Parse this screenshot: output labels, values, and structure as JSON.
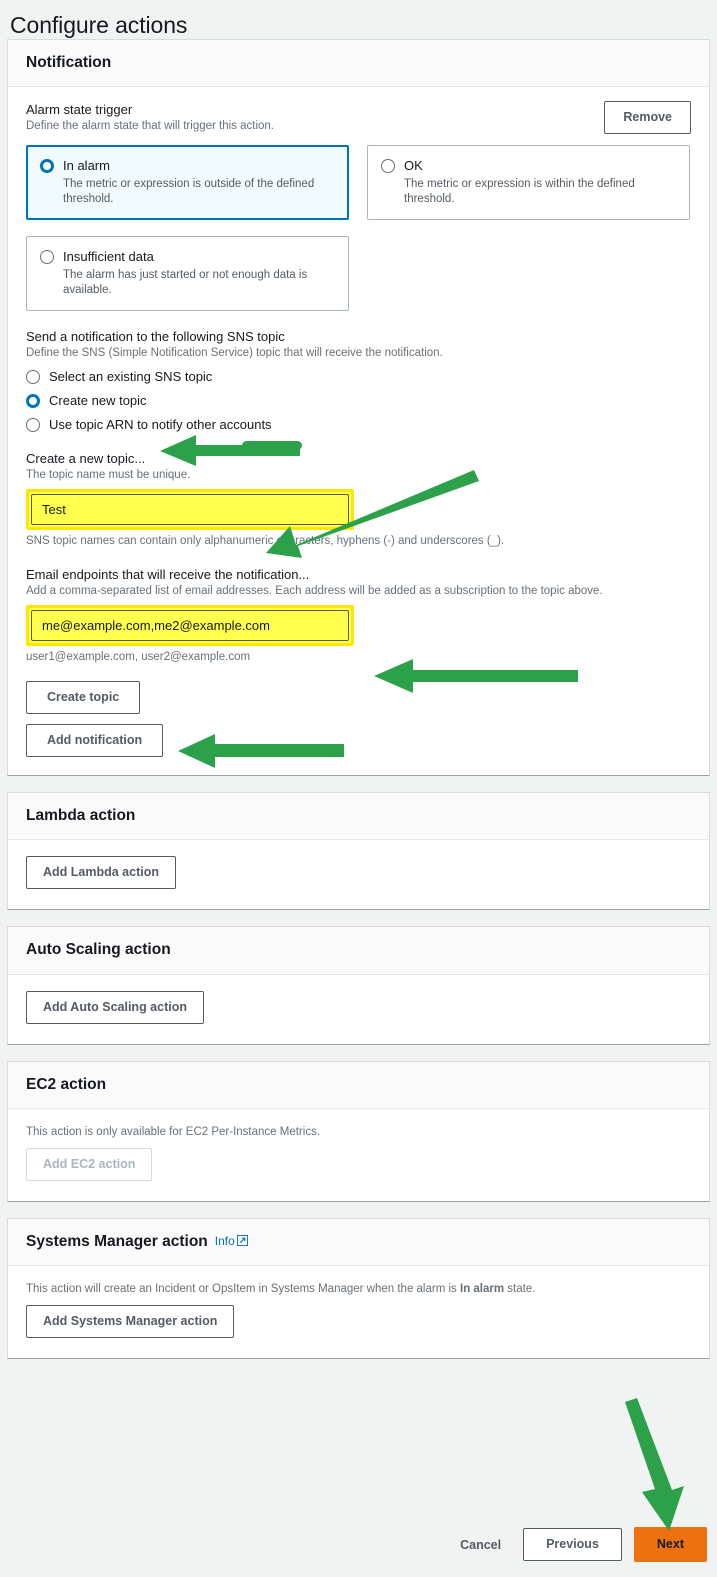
{
  "page": {
    "title": "Configure actions",
    "accent_green": "#2CA14A",
    "accent_orange": "#ec7211",
    "highlight_yellow": "#ffff4d",
    "link_blue": "#0073bb"
  },
  "notification": {
    "heading": "Notification",
    "remove_label": "Remove",
    "alarm_state_trigger": {
      "label": "Alarm state trigger",
      "description": "Define the alarm state that will trigger this action.",
      "options": [
        {
          "title": "In alarm",
          "description": "The metric or expression is outside of the defined threshold.",
          "selected": true
        },
        {
          "title": "OK",
          "description": "The metric or expression is within the defined threshold.",
          "selected": false
        },
        {
          "title": "Insufficient data",
          "description": "The alarm has just started or not enough data is available.",
          "selected": false
        }
      ]
    },
    "sns": {
      "label": "Send a notification to the following SNS topic",
      "description": "Define the SNS (Simple Notification Service) topic that will receive the notification.",
      "options": [
        {
          "label": "Select an existing SNS topic",
          "selected": false
        },
        {
          "label": "Create new topic",
          "selected": true
        },
        {
          "label": "Use topic ARN to notify other accounts",
          "selected": false
        }
      ]
    },
    "topic_name": {
      "label": "Create a new topic...",
      "description": "The topic name must be unique.",
      "value": "Test",
      "placeholder": "",
      "hint": "SNS topic names can contain only alphanumeric characters, hyphens (-) and underscores (_)."
    },
    "email_endpoints": {
      "label": "Email endpoints that will receive the notification...",
      "description": "Add a comma-separated list of email addresses. Each address will be added as a subscription to the topic above.",
      "value": "me@example.com,me2@example.com",
      "placeholder": "",
      "hint": "user1@example.com, user2@example.com"
    },
    "create_topic_label": "Create topic",
    "add_notification_label": "Add notification"
  },
  "lambda": {
    "heading": "Lambda action",
    "add_label": "Add Lambda action"
  },
  "autoscaling": {
    "heading": "Auto Scaling action",
    "add_label": "Add Auto Scaling action"
  },
  "ec2": {
    "heading": "EC2 action",
    "note": "This action is only available for EC2 Per-Instance Metrics.",
    "add_label": "Add EC2 action",
    "add_disabled": true
  },
  "ssm": {
    "heading": "Systems Manager action",
    "info_label": "Info",
    "note_before": "This action will create an Incident or OpsItem in Systems Manager when the alarm is ",
    "note_bold": "In alarm",
    "note_after": " state.",
    "add_label": "Add Systems Manager action"
  },
  "footer": {
    "cancel_label": "Cancel",
    "previous_label": "Previous",
    "next_label": "Next"
  }
}
